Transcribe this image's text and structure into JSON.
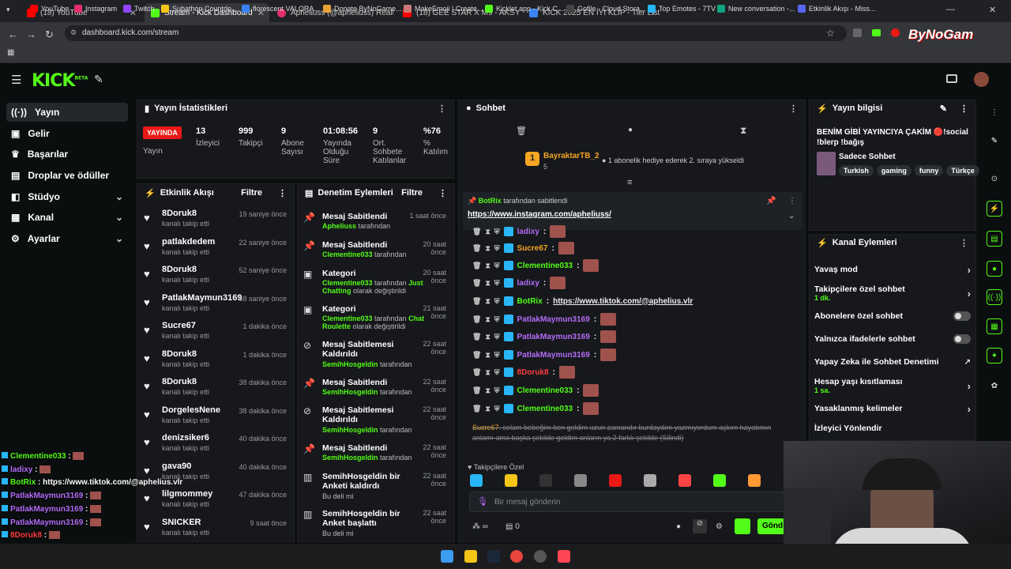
{
  "browser": {
    "tabs": [
      {
        "label": "(18) YouTube",
        "color": "#ff0000"
      },
      {
        "label": "Stream - Kick Dashboard",
        "color": "#53fc18"
      },
      {
        "label": "Apheliuss (@apheliuss) Realtim",
        "color": "#e1306c"
      },
      {
        "label": "(18) GEE STAR X M9 - AKSYON",
        "color": "#ff0000"
      },
      {
        "label": "KİCK 2025 EN İYİ KLİP - Tier List",
        "color": "#3b82f6"
      }
    ],
    "url": "dashboard.kick.com/stream",
    "bookmarks": [
      "YouTube",
      "Instagram",
      "Twitch",
      "Subathon Countdo...",
      "florescent VALORA...",
      "Donate ByNoGame...",
      "MakeEmoji | Create...",
      "Kicklet.app - Kick C...",
      "Gofile - Cloud Stora...",
      "Top Emotes - 7TV",
      "New conversation -...",
      "Etkinlik Akışı - Miss..."
    ],
    "watermark": "ByNoGam"
  },
  "header": {
    "logo": "KICK",
    "beta": "BETA"
  },
  "sidebar": {
    "items": [
      {
        "label": "Yayın",
        "icon": "broadcast-icon"
      },
      {
        "label": "Gelir",
        "icon": "wallet-icon"
      },
      {
        "label": "Başarılar",
        "icon": "trophy-icon"
      },
      {
        "label": "Droplar ve ödüller",
        "icon": "gift-icon"
      },
      {
        "label": "Stüdyo",
        "icon": "studio-icon"
      },
      {
        "label": "Kanal",
        "icon": "channel-icon"
      },
      {
        "label": "Ayarlar",
        "icon": "gear-icon"
      }
    ]
  },
  "stats": {
    "title": "Yayın İstatistikleri",
    "live_badge": "YAYINDA",
    "items": [
      {
        "value": "",
        "label": "Yayın"
      },
      {
        "value": "13",
        "label": "İzleyici"
      },
      {
        "value": "999",
        "label": "Takipçi"
      },
      {
        "value": "9",
        "label": "Abone Sayısı"
      },
      {
        "value": "01:08:56",
        "label": "Yayında Olduğu Süre"
      },
      {
        "value": "9",
        "label": "Ort. Sohbete Katılanlar"
      },
      {
        "value": "%76",
        "label": "% Katılım"
      }
    ]
  },
  "activity": {
    "title": "Etkinlik Akışı",
    "filter": "Filtre",
    "items": [
      {
        "name": "8Doruk8",
        "sub": "kanalı takip etti",
        "time": "19 saniye önce"
      },
      {
        "name": "patlakdedem",
        "sub": "kanalı takip etti",
        "time": "22 saniye önce"
      },
      {
        "name": "8Doruk8",
        "sub": "kanalı takip etti",
        "time": "52 saniye önce"
      },
      {
        "name": "PatlakMaymun3169",
        "sub": "kanalı takip etti",
        "time": "58 saniye önce"
      },
      {
        "name": "Sucre67",
        "sub": "kanalı takip etti",
        "time": "1 dakika önce"
      },
      {
        "name": "8Doruk8",
        "sub": "kanalı takip etti",
        "time": "1 dakika önce"
      },
      {
        "name": "8Doruk8",
        "sub": "kanalı takip etti",
        "time": "38 dakika önce"
      },
      {
        "name": "DorgelesNene",
        "sub": "kanalı takip etti",
        "time": "38 dakika önce"
      },
      {
        "name": "denizsiker6",
        "sub": "kanalı takip etti",
        "time": "40 dakika önce"
      },
      {
        "name": "gava90",
        "sub": "kanalı takip etti",
        "time": "40 dakika önce"
      },
      {
        "name": "lilgmommey",
        "sub": "kanalı takip etti",
        "time": "47 dakika önce"
      },
      {
        "name": "SNICKER",
        "sub": "kanalı takip etti",
        "time": "9 saat önce"
      }
    ]
  },
  "moderation": {
    "title": "Denetim Eylemleri",
    "filter": "Filtre",
    "items": [
      {
        "icon": "pin-icon",
        "title": "Mesaj Sabitlendi",
        "user": "Apheliuss",
        "rest": " tarafından",
        "extra": "",
        "tail": "",
        "time": "1 saat önce"
      },
      {
        "icon": "pin-icon",
        "title": "Mesaj Sabitlendi",
        "user": "Clementine033",
        "rest": " tarafından",
        "extra": "",
        "tail": "",
        "time": "20 saat önce"
      },
      {
        "icon": "category-icon",
        "title": "Kategori",
        "user": "Clementine033",
        "rest": " tarafından ",
        "extra": "Just Chatting",
        "tail": " olarak değiştirildi",
        "time": "20 saat önce"
      },
      {
        "icon": "category-icon",
        "title": "Kategori",
        "user": "Clementine033",
        "rest": " tarafından ",
        "extra": "Chat Roulette",
        "tail": " olarak değiştirildi",
        "time": "21 saat önce"
      },
      {
        "icon": "unpin-icon",
        "title": "Mesaj Sabitlemesi Kaldırıldı",
        "user": "SemihHosgeldin",
        "rest": " tarafından",
        "extra": "",
        "tail": "",
        "time": "22 saat önce"
      },
      {
        "icon": "pin-icon",
        "title": "Mesaj Sabitlendi",
        "user": "SemihHosgeldin",
        "rest": " tarafından",
        "extra": "",
        "tail": "",
        "time": "22 saat önce"
      },
      {
        "icon": "unpin-icon",
        "title": "Mesaj Sabitlemesi Kaldırıldı",
        "user": "SemihHosgeldin",
        "rest": " tarafından",
        "extra": "",
        "tail": "",
        "time": "22 saat önce"
      },
      {
        "icon": "pin-icon",
        "title": "Mesaj Sabitlendi",
        "user": "SemihHosgeldin",
        "rest": " tarafından",
        "extra": "",
        "tail": "",
        "time": "22 saat önce"
      },
      {
        "icon": "poll-icon",
        "title": "SemihHosgeldin bir Anketi kaldırdı",
        "user": "",
        "rest": "Bu deli mi",
        "extra": "",
        "tail": "",
        "time": "22 saat önce"
      },
      {
        "icon": "poll-icon",
        "title": "SemihHosgeldin bir Anket başlattı",
        "user": "",
        "rest": "Bu deli mi",
        "extra": "",
        "tail": "",
        "time": "22 saat önce"
      }
    ]
  },
  "chat": {
    "title": "Sohbet",
    "gift": {
      "user": "BayraktarTB_2",
      "count": "5",
      "text": "1 abonelik hediye ederek 2. sıraya yükseldi",
      "rank": "1"
    },
    "pinned": {
      "by": "BotRix",
      "by_suffix": " tarafından sabitlendi",
      "link": "https://www.instagram.com/apheliuss/"
    },
    "messages": [
      {
        "user": "ladixy",
        "color": "#b36cf7",
        "text": ""
      },
      {
        "user": "Sucre67",
        "color": "#f5a623",
        "text": ""
      },
      {
        "user": "Clementine033",
        "color": "#53fc18",
        "text": ""
      },
      {
        "user": "ladixy",
        "color": "#b36cf7",
        "text": ""
      },
      {
        "user": "BotRix",
        "color": "#53fc18",
        "text": "https://www.tiktok.com/@aphelius.vlr"
      },
      {
        "user": "PatlakMaymun3169",
        "color": "#b36cf7",
        "text": ""
      },
      {
        "user": "PatlakMaymun3169",
        "color": "#b36cf7",
        "text": ""
      },
      {
        "user": "PatlakMaymun3169",
        "color": "#b36cf7",
        "text": ""
      },
      {
        "user": "8Doruk8",
        "color": "#ff3b3b",
        "text": ""
      },
      {
        "user": "Clementine033",
        "color": "#53fc18",
        "text": ""
      },
      {
        "user": "Clementine033",
        "color": "#53fc18",
        "text": ""
      }
    ],
    "deleted": {
      "user": "Sucre67",
      "text": "selam bebeğim ben geldim uzun zamandır burdaydım yazmıyordum aşkım hayatımın anlamı ama başka şekilde geldim anların ya 2 farklı şekilde",
      "tag": "(Silindi)"
    },
    "followers_only": "Takipçilere Özel",
    "input_placeholder": "Bir mesaj gönderin",
    "send": "Gönd",
    "count": "0"
  },
  "info": {
    "title": "Yayın bilgisi",
    "stream_title": "BENİM GİBİ YAYINCIYA ÇAKİM 🔴!social !blerp !bağış",
    "category": "Sadece Sohbet",
    "tags": [
      "Turkish",
      "gaming",
      "funny",
      "Türkçe"
    ],
    "viewers": ""
  },
  "actions": {
    "title": "Kanal Eylemleri",
    "items": [
      {
        "label": "Yavaş mod",
        "sub": "",
        "type": "arrow"
      },
      {
        "label": "Takipçilere özel sohbet",
        "sub": "1 dk.",
        "type": "arrow"
      },
      {
        "label": "Abonelere özel sohbet",
        "sub": "",
        "type": "toggle"
      },
      {
        "label": "Yalnızca ifadelerle sohbet",
        "sub": "",
        "type": "toggle"
      },
      {
        "label": "Yapay Zeka ile Sohbet Denetimi",
        "sub": "",
        "type": "ext"
      },
      {
        "label": "Hesap yaşı kısıtlaması",
        "sub": "1 sa.",
        "type": "arrow"
      },
      {
        "label": "Yasaklanmış kelimeler",
        "sub": "",
        "type": "arrow"
      },
      {
        "label": "İzleyici Yönlendir",
        "sub": "",
        "type": "none"
      }
    ]
  },
  "overlay_chat": [
    {
      "user": "Clementine033",
      "color": "#53fc18",
      "text": ""
    },
    {
      "user": "ladixy",
      "color": "#b36cf7",
      "text": ""
    },
    {
      "user": "BotRix",
      "color": "#53fc18",
      "text": "https://www.tiktok.com/@aphelius.vlr"
    },
    {
      "user": "PatlakMaymun3169",
      "color": "#b36cf7",
      "text": ""
    },
    {
      "user": "PatlakMaymun3169",
      "color": "#b36cf7",
      "text": ""
    },
    {
      "user": "PatlakMaymun3169",
      "color": "#b36cf7",
      "text": ""
    },
    {
      "user": "8Doruk8",
      "color": "#ff3b3b",
      "text": ""
    },
    {
      "user": "Clementine033",
      "color": "#53fc18",
      "text": ""
    },
    {
      "user": "Clementine033",
      "color": "#53fc18",
      "text": ""
    }
  ],
  "colors": {
    "accent": "#53fc18",
    "live": "#e91916",
    "purple": "#b36cf7"
  }
}
